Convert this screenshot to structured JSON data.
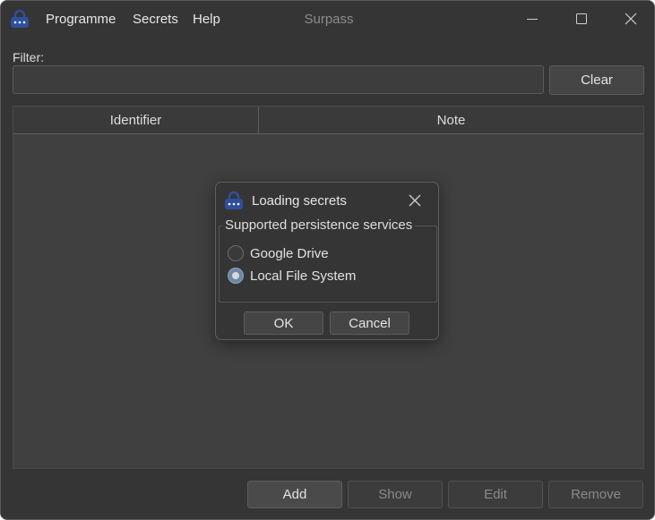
{
  "app": {
    "title": "Surpass",
    "icon": "lock-icon",
    "menu": [
      "Programme",
      "Secrets",
      "Help"
    ]
  },
  "window_controls": {
    "minimize_icon": "minimize-icon",
    "maximize_icon": "maximize-icon",
    "close_icon": "close-icon"
  },
  "filter": {
    "label": "Filter:",
    "value": "",
    "clear_label": "Clear"
  },
  "table": {
    "columns": [
      "Identifier",
      "Note"
    ],
    "rows": []
  },
  "actions": {
    "add": "Add",
    "show": "Show",
    "edit": "Edit",
    "remove": "Remove"
  },
  "dialog": {
    "title": "Loading secrets",
    "group_title": "Supported persistence services",
    "options": [
      {
        "label": "Google Drive",
        "checked": false
      },
      {
        "label": "Local File System",
        "checked": true
      }
    ],
    "ok_label": "OK",
    "cancel_label": "Cancel"
  },
  "colors": {
    "window_bg": "#353535",
    "table_bg": "#404040",
    "accent": "#6d86a5",
    "icon_blue": "#2f4f9e"
  }
}
